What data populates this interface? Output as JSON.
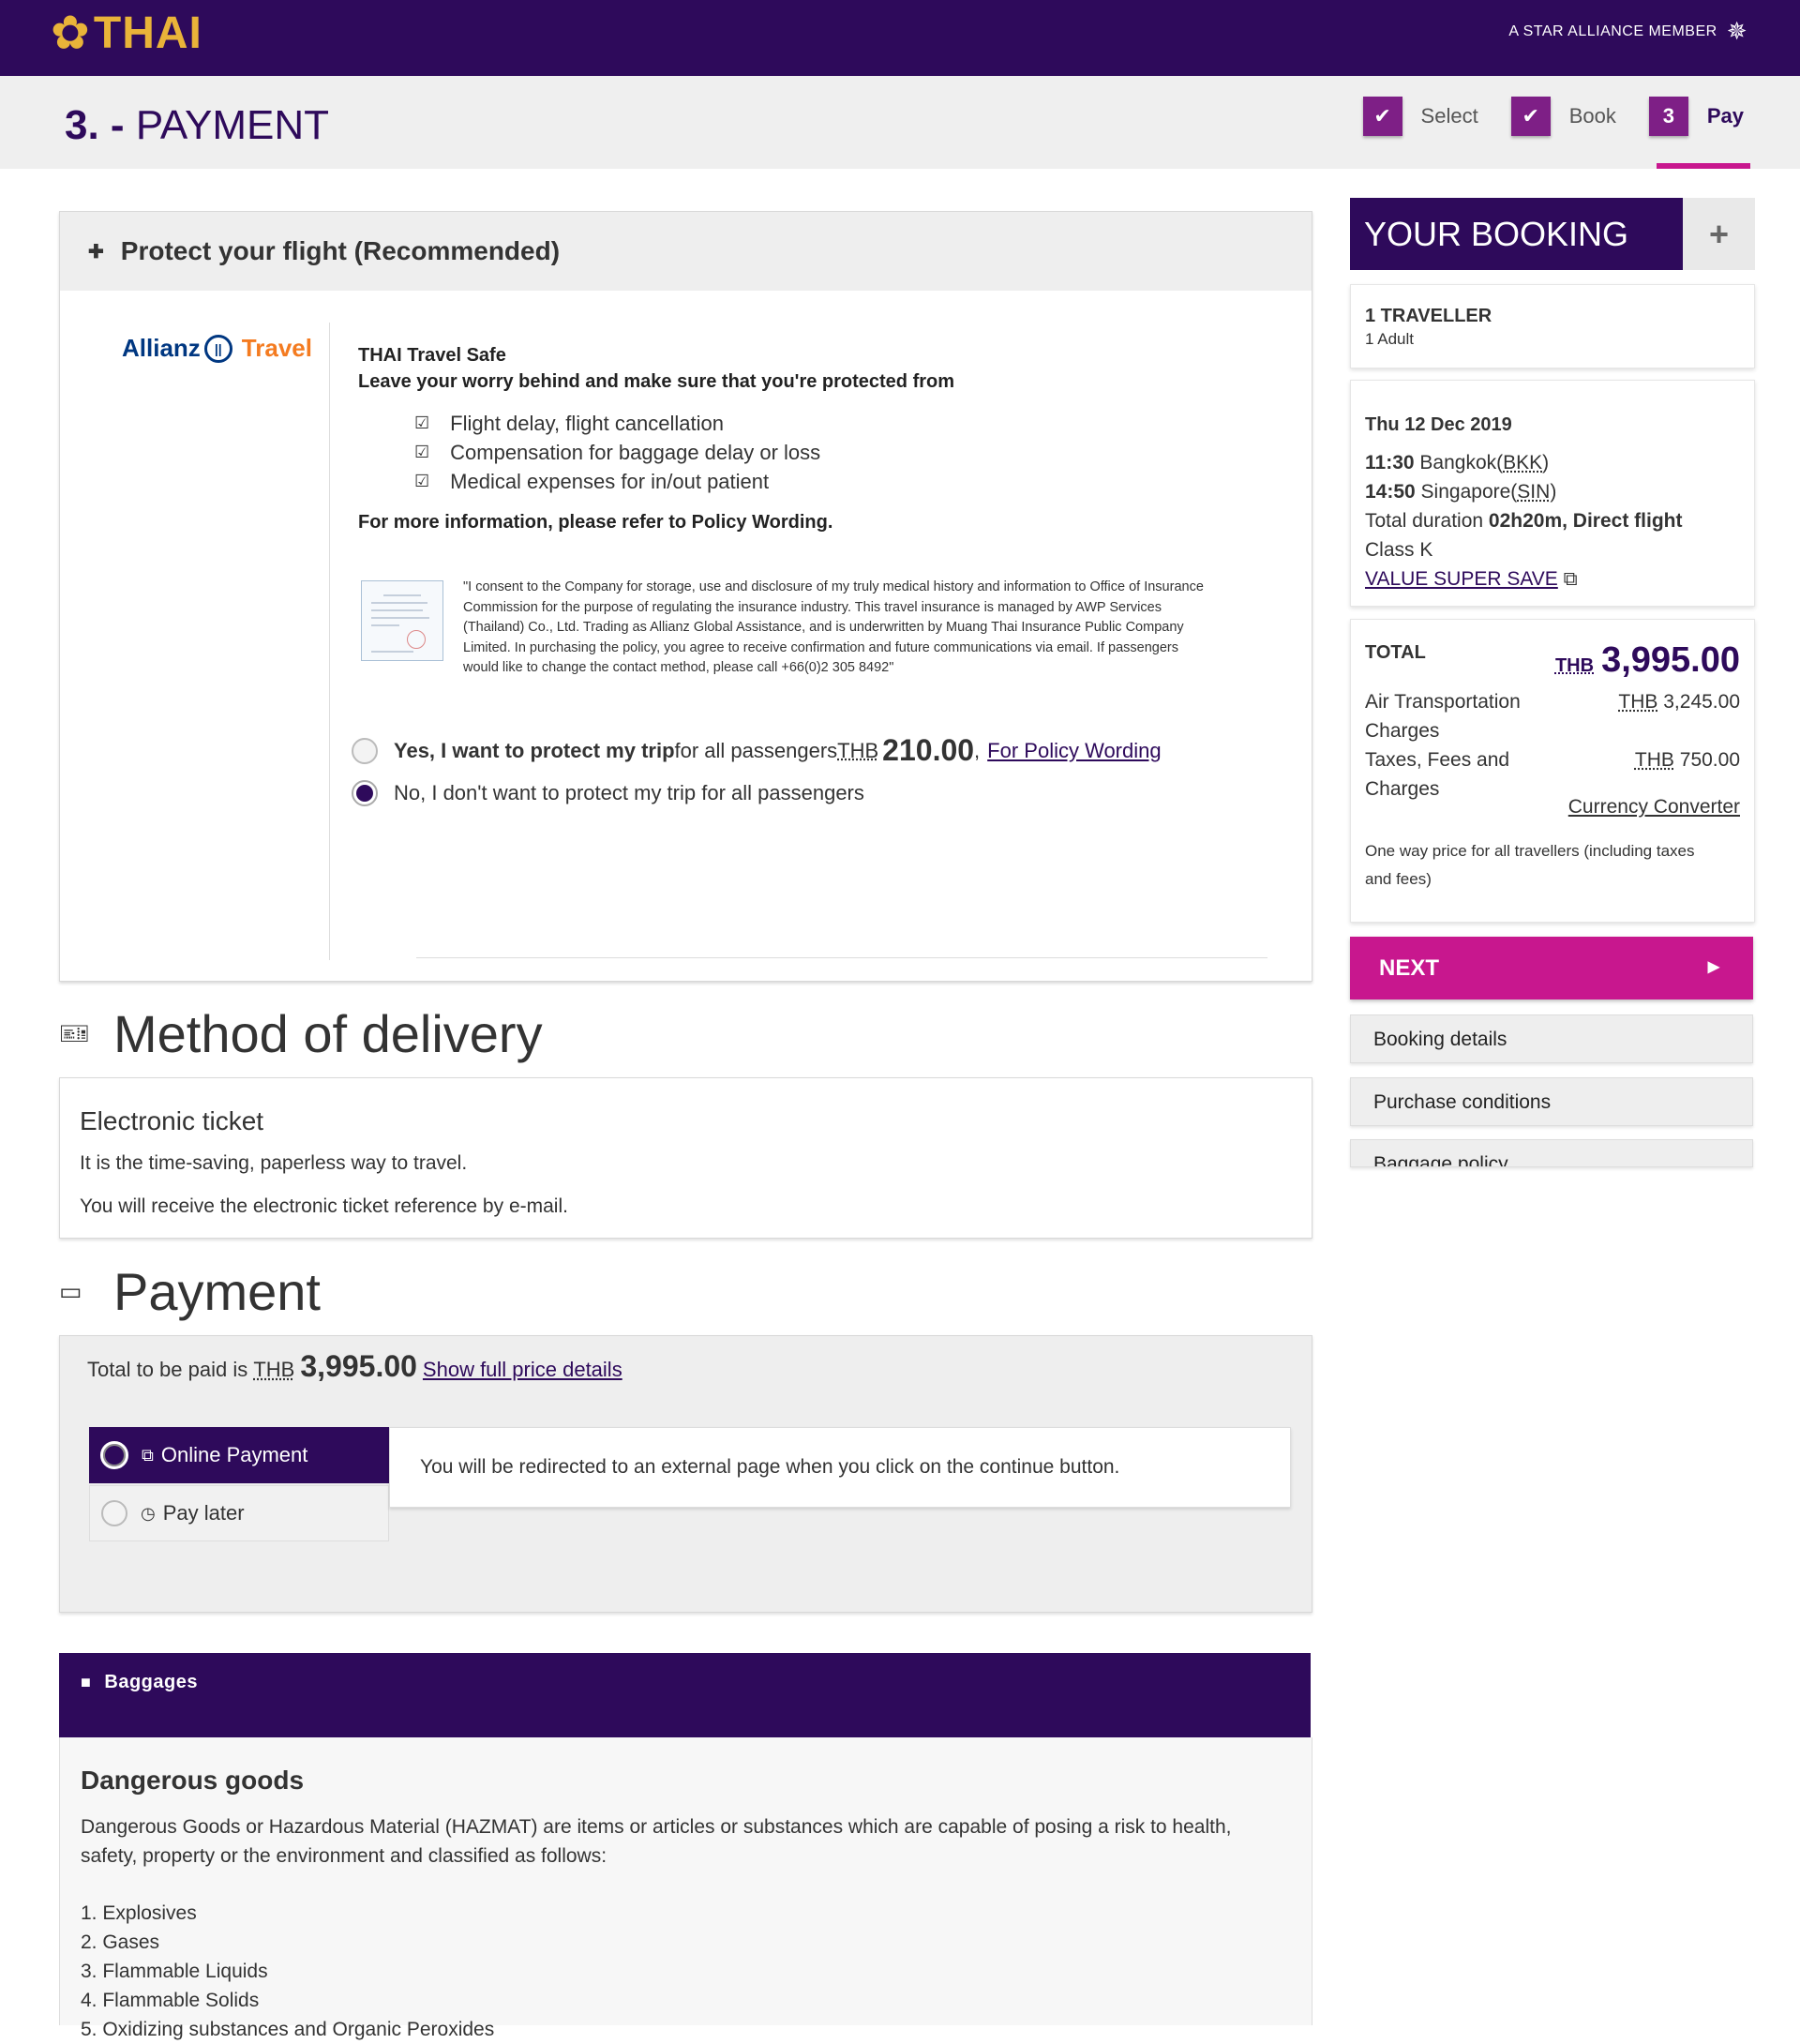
{
  "header": {
    "logo_text": "THAI",
    "alliance_text": "A STAR ALLIANCE MEMBER"
  },
  "title": {
    "number": "3. -",
    "label": "PAYMENT"
  },
  "steps": [
    {
      "label": "Select",
      "marker": "✔"
    },
    {
      "label": "Book",
      "marker": "✔"
    },
    {
      "label": "Pay",
      "marker": "3"
    }
  ],
  "protect": {
    "header": "Protect your flight (Recommended)",
    "logo_left": "Allianz",
    "logo_right": "Travel",
    "product": "THAI Travel Safe",
    "subtitle": "Leave your worry behind and make sure that you're protected from",
    "benefits": [
      "Flight delay, flight cancellation",
      "Compensation for baggage delay or loss",
      "Medical expenses for in/out patient"
    ],
    "more_info": "For more information, please refer to Policy Wording.",
    "consent": "\"I consent to the Company for storage, use and disclosure of my truly medical history and information to Office of Insurance Commission for the purpose of regulating the insurance industry. This travel insurance is managed by AWP Services (Thailand) Co., Ltd. Trading as Allianz Global Assistance, and is underwritten by Muang Thai Insurance Public Company Limited. In purchasing the policy, you agree to receive confirmation and future communications via email. If passengers would like to change the contact method, please call +66(0)2 305 8492\"",
    "yes_bold": "Yes, I want to protect my trip",
    "yes_rest": " for all passengers",
    "yes_currency": "THB",
    "yes_price": "210.00",
    "yes_comma": ",",
    "policy_link": "For Policy Wording",
    "no_label": "No, I don't want to protect my trip for all passengers",
    "selected": "no"
  },
  "delivery": {
    "section_title": "Method of delivery",
    "type": "Electronic ticket",
    "line1": "It is the time-saving, paperless way to travel.",
    "line2": "You will receive the electronic ticket reference by e-mail."
  },
  "payment": {
    "section_title": "Payment",
    "total_prefix": "Total to be paid is",
    "currency": "THB",
    "total": "3,995.00",
    "details_link": "Show full price details",
    "options": [
      {
        "label": "Online Payment",
        "selected": true
      },
      {
        "label": "Pay later",
        "selected": false
      }
    ],
    "redirect_note": "You will be redirected to an external page when you click on the continue button."
  },
  "baggages": {
    "header": "Baggages",
    "title": "Dangerous goods",
    "description": "Dangerous Goods or Hazardous Material (HAZMAT) are items or articles or substances which are capable of posing a risk to health, safety, property or the environment and classified as follows:",
    "items": [
      "1. Explosives",
      "2. Gases",
      "3. Flammable Liquids",
      "4. Flammable Solids",
      "5. Oxidizing substances and Organic Peroxides"
    ]
  },
  "booking": {
    "title": "YOUR BOOKING",
    "expand": "+",
    "travellers": "1 TRAVELLER",
    "traveller_type": "1 Adult",
    "date": "Thu 12 Dec 2019",
    "dep_time": "11:30",
    "dep_city": " Bangkok(",
    "dep_code": "BKK",
    "arr_time": "14:50",
    "arr_city": " Singapore(",
    "arr_code": "SIN",
    "close_paren": ")",
    "duration_prefix": "Total duration ",
    "duration": "02h20m, Direct flight",
    "class": "Class K",
    "fare_link": "VALUE SUPER SAVE",
    "total_label": "TOTAL",
    "total_currency": "THB",
    "total_amount": "3,995.00",
    "charges": [
      {
        "label1": "Air Transportation",
        "label2": "Charges",
        "currency": "THB",
        "amount": "3,245.00"
      },
      {
        "label1": "Taxes, Fees and",
        "label2": "Charges",
        "currency": "THB",
        "amount": "750.00"
      }
    ],
    "converter_link": "Currency Converter",
    "note1": "One way price for all travellers (including taxes",
    "note2": "and fees)",
    "next_label": "NEXT",
    "links": [
      "Booking details",
      "Purchase conditions",
      "Baggage policy"
    ]
  },
  "colors": {
    "brand_purple": "#2e0a5b",
    "accent_magenta": "#c8178e",
    "step_purple": "#7e1f86",
    "logo_gold": "#e9b339"
  }
}
